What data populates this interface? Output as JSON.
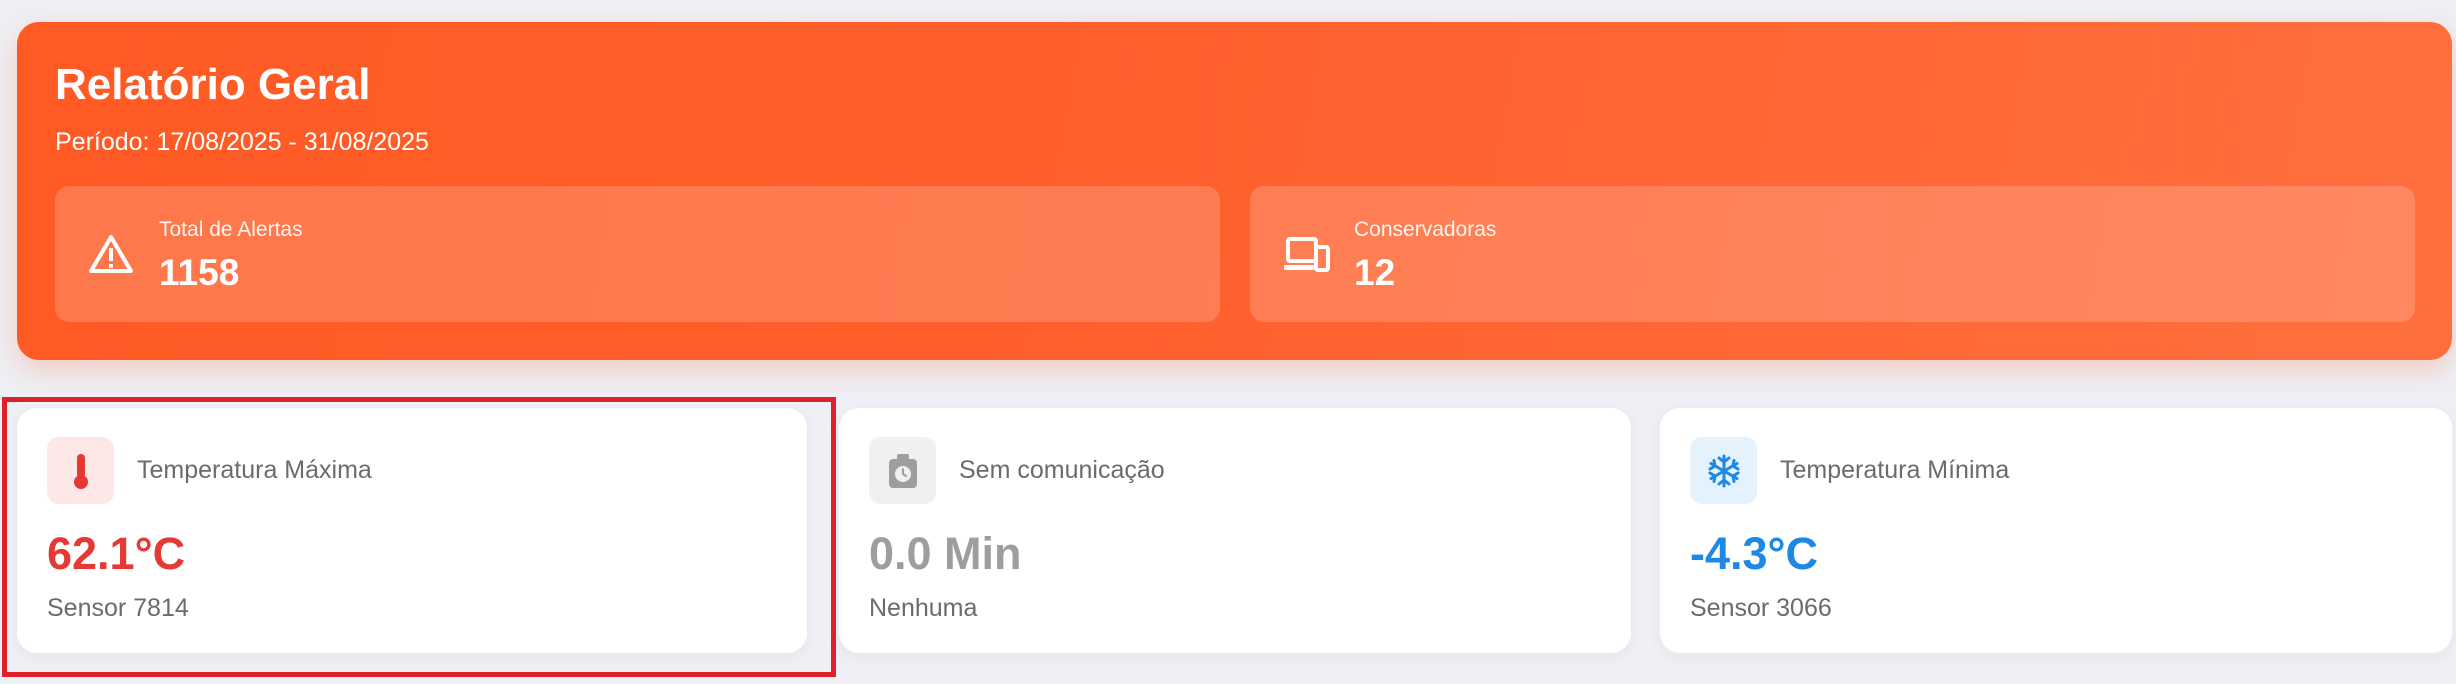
{
  "report": {
    "title": "Relatório Geral",
    "period": "Período: 17/08/2025 - 31/08/2025",
    "stats": [
      {
        "label": "Total de Alertas",
        "value": "1158",
        "icon": "warning-icon"
      },
      {
        "label": "Conservadoras",
        "value": "12",
        "icon": "devices-icon"
      }
    ]
  },
  "cards": [
    {
      "label": "Temperatura Máxima",
      "value": "62.1°C",
      "sub": "Sensor 7814",
      "icon": "thermometer-icon",
      "accent": "#e53935",
      "icon_bg": "#fde7e7"
    },
    {
      "label": "Sem comunicação",
      "value": "0.0 Min",
      "sub": "Nenhuma",
      "icon": "timer-icon",
      "accent": "#9e9e9e",
      "icon_bg": "#f0f0f0"
    },
    {
      "label": "Temperatura Mínima",
      "value": "-4.3°C",
      "sub": "Sensor 3066",
      "icon": "snowflake-icon",
      "accent": "#1e88e5",
      "icon_bg": "#e3f2fd"
    }
  ],
  "colors": {
    "banner": "#ff5a24",
    "highlight": "#e0202a"
  }
}
